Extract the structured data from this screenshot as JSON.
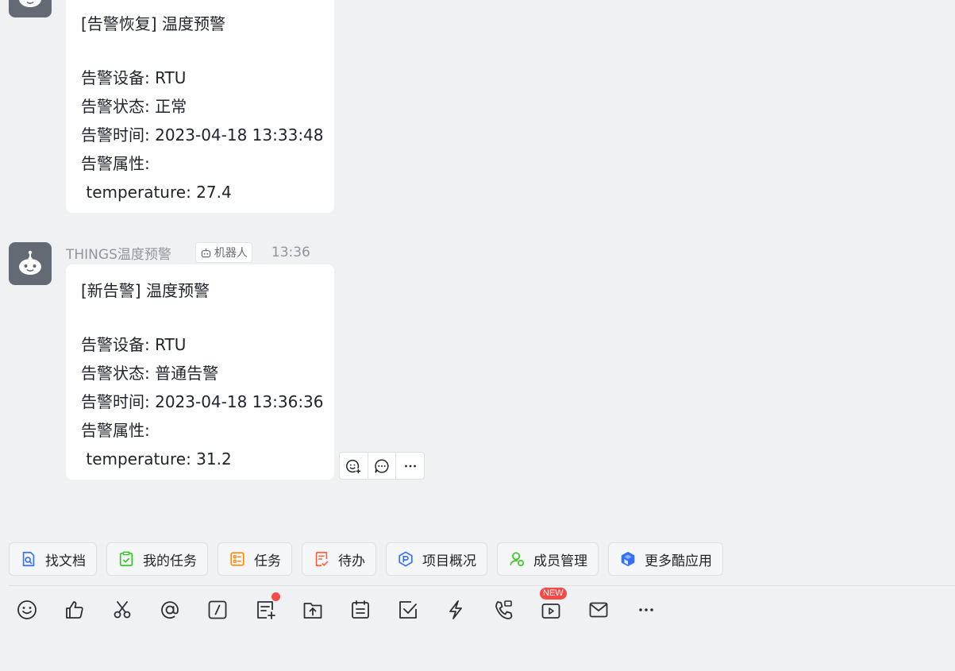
{
  "message1": {
    "lines": [
      "[告警恢复] 温度预警",
      "",
      "告警设备: RTU",
      "告警状态: 正常",
      "告警时间: 2023-04-18 13:33:48",
      "告警属性:",
      " temperature: 27.4"
    ]
  },
  "message2": {
    "sender": "THINGS温度预警",
    "tag": "机器人",
    "time": "13:36",
    "lines": [
      "[新告警] 温度预警",
      "",
      "告警设备: RTU",
      "告警状态: 普通告警",
      "告警时间: 2023-04-18 13:36:36",
      "告警属性:",
      " temperature: 31.2"
    ]
  },
  "message_actions": [
    "add-reaction-icon",
    "reply-icon",
    "more-icon"
  ],
  "shortcuts": [
    {
      "label": "找文档",
      "icon": "doc-search-icon",
      "color": "#3370ff"
    },
    {
      "label": "我的任务",
      "icon": "my-task-icon",
      "color": "#34c724"
    },
    {
      "label": "任务",
      "icon": "task-icon",
      "color": "#ff8800"
    },
    {
      "label": "待办",
      "icon": "todo-icon",
      "color": "#f5613a"
    },
    {
      "label": "项目概况",
      "icon": "project-icon",
      "color": "#3370ff"
    },
    {
      "label": "成员管理",
      "icon": "member-icon",
      "color": "#34c724"
    },
    {
      "label": "更多酷应用",
      "icon": "cool-apps-icon",
      "color": "#3370ff"
    }
  ],
  "toolbar": {
    "new_badge": "NEW",
    "tools": [
      "emoji-icon",
      "thumbs-up-icon",
      "screenshot-icon",
      "at-icon",
      "slash-command-icon",
      "doc-plus-icon",
      "upload-file-icon",
      "calendar-icon",
      "check-task-icon",
      "quick-action-icon",
      "call-icon",
      "live-icon",
      "mail-icon",
      "more-icon"
    ]
  }
}
